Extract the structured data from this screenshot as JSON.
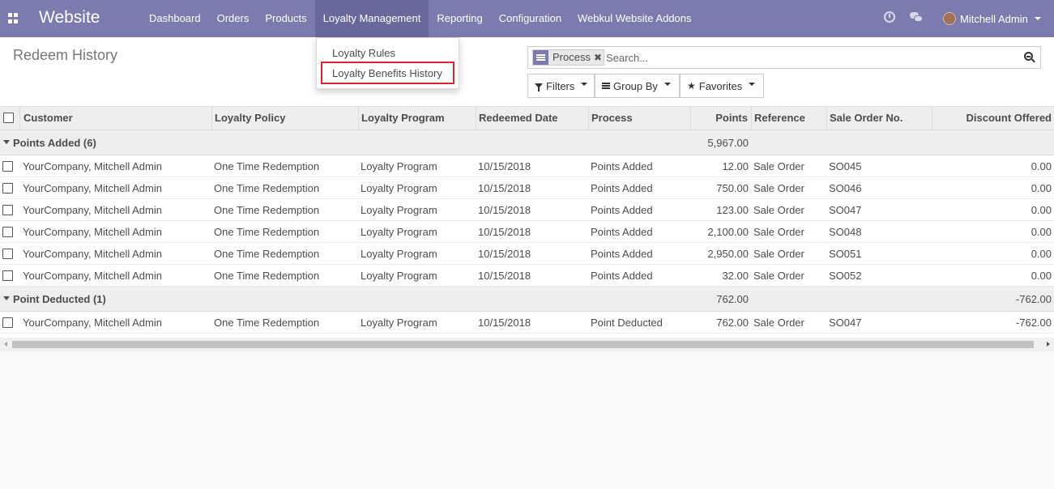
{
  "navbar": {
    "brand": "Website",
    "menu": [
      "Dashboard",
      "Orders",
      "Products",
      "Loyalty Management",
      "Reporting",
      "Configuration",
      "Webkul Website Addons"
    ],
    "user_name": "Mitchell Admin",
    "color": "#7c7bad"
  },
  "dropdown": {
    "items": [
      "Loyalty Rules",
      "Loyalty Benefits History"
    ],
    "highlight_color": "#d9262e"
  },
  "control_panel": {
    "title": "Redeem History",
    "facet_value": "Process",
    "search_placeholder": "Search...",
    "filters_label": "Filters",
    "groupby_label": "Group By",
    "favorites_label": "Favorites"
  },
  "table": {
    "columns": [
      "Customer",
      "Loyalty Policy",
      "Loyalty Program",
      "Redeemed Date",
      "Process",
      "Points",
      "Reference",
      "Sale Order No.",
      "Discount Offered"
    ],
    "groups": [
      {
        "label": "Points Added (6)",
        "points_total": "5,967.00",
        "discount_total": "",
        "rows": [
          {
            "customer": "YourCompany, Mitchell Admin",
            "policy": "One Time Redemption",
            "program": "Loyalty Program",
            "date": "10/15/2018",
            "process": "Points Added",
            "points": "12.00",
            "reference": "Sale Order",
            "so": "SO045",
            "discount": "0.00"
          },
          {
            "customer": "YourCompany, Mitchell Admin",
            "policy": "One Time Redemption",
            "program": "Loyalty Program",
            "date": "10/15/2018",
            "process": "Points Added",
            "points": "750.00",
            "reference": "Sale Order",
            "so": "SO046",
            "discount": "0.00"
          },
          {
            "customer": "YourCompany, Mitchell Admin",
            "policy": "One Time Redemption",
            "program": "Loyalty Program",
            "date": "10/15/2018",
            "process": "Points Added",
            "points": "123.00",
            "reference": "Sale Order",
            "so": "SO047",
            "discount": "0.00"
          },
          {
            "customer": "YourCompany, Mitchell Admin",
            "policy": "One Time Redemption",
            "program": "Loyalty Program",
            "date": "10/15/2018",
            "process": "Points Added",
            "points": "2,100.00",
            "reference": "Sale Order",
            "so": "SO048",
            "discount": "0.00"
          },
          {
            "customer": "YourCompany, Mitchell Admin",
            "policy": "One Time Redemption",
            "program": "Loyalty Program",
            "date": "10/15/2018",
            "process": "Points Added",
            "points": "2,950.00",
            "reference": "Sale Order",
            "so": "SO051",
            "discount": "0.00"
          },
          {
            "customer": "YourCompany, Mitchell Admin",
            "policy": "One Time Redemption",
            "program": "Loyalty Program",
            "date": "10/15/2018",
            "process": "Points Added",
            "points": "32.00",
            "reference": "Sale Order",
            "so": "SO052",
            "discount": "0.00"
          }
        ]
      },
      {
        "label": "Point Deducted (1)",
        "points_total": "762.00",
        "discount_total": "-762.00",
        "rows": [
          {
            "customer": "YourCompany, Mitchell Admin",
            "policy": "One Time Redemption",
            "program": "Loyalty Program",
            "date": "10/15/2018",
            "process": "Point Deducted",
            "points": "762.00",
            "reference": "Sale Order",
            "so": "SO047",
            "discount": "-762.00"
          }
        ]
      }
    ]
  }
}
